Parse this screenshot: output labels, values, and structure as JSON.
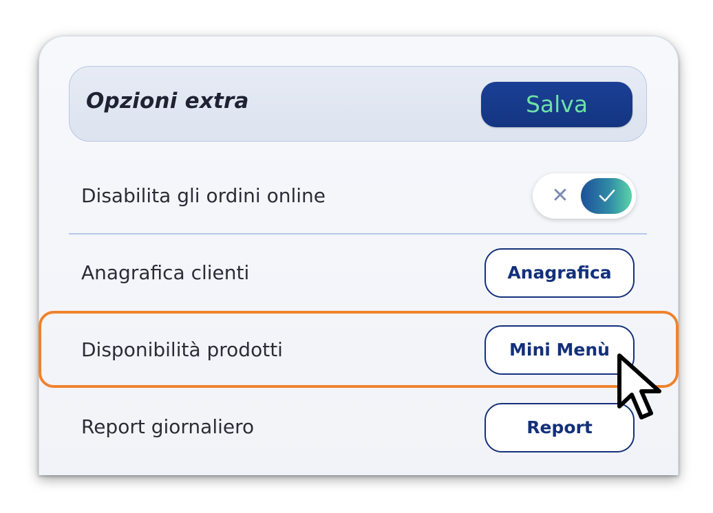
{
  "header": {
    "title": "Opzioni extra",
    "save_label": "Salva"
  },
  "rows": [
    {
      "label": "Disabilita gli ordini online",
      "control": "toggle",
      "toggle_on": true
    },
    {
      "label": "Anagrafica clienti",
      "button_label": "Anagrafica"
    },
    {
      "label": "Disponibilità prodotti",
      "button_label": "Mini Menù",
      "highlighted": true
    },
    {
      "label": "Report giornaliero",
      "button_label": "Report"
    }
  ],
  "icons": {
    "toggle_off": "close-icon",
    "toggle_on": "check-icon",
    "pointer": "mouse-pointer-icon"
  },
  "toggle_off_glyph": "✕",
  "colors": {
    "accent": "#133581",
    "save_text": "#6ee0a8",
    "highlight": "#f0822d",
    "divider": "#b5c7e6"
  }
}
